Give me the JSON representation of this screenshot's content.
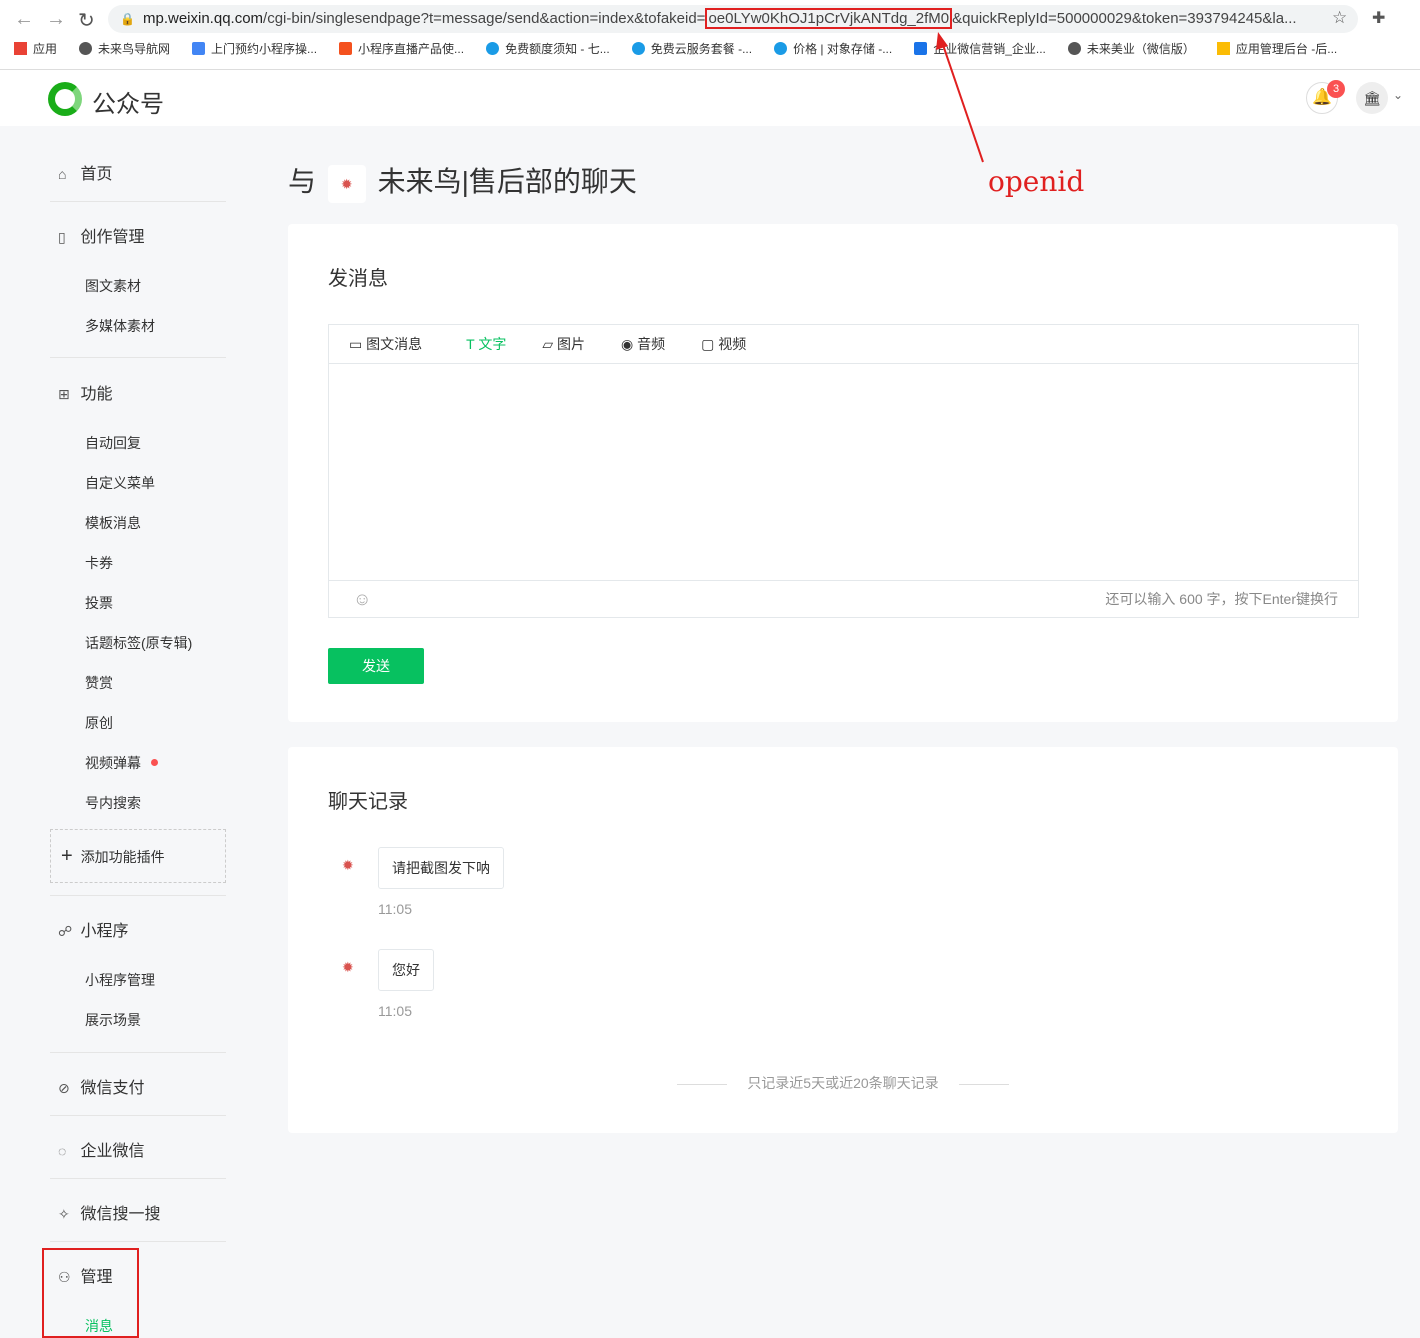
{
  "browser": {
    "url_prefix": "mp.weixin.qq.com",
    "url_path": "/cgi-bin/singlesendpage?t=message/send&action=index&tofakeid=",
    "url_highlight": "oe0LYw0KhOJ1pCrVjkANTdg_2fM0",
    "url_suffix": "&quickReplyId=500000029&token=393794245&la...",
    "bookmarks": [
      "应用",
      "未来鸟导航网",
      "上门预约小程序操...",
      "小程序直播产品使...",
      "免费额度须知 - 七...",
      "免费云服务套餐 -...",
      "价格 | 对象存储 -...",
      "企业微信营销_企业...",
      "未来美业（微信版）",
      "应用管理后台 -后..."
    ]
  },
  "header": {
    "logo": "公众号",
    "notifications": "3"
  },
  "sidebar": {
    "home": "首页",
    "create": "创作管理",
    "create_items": [
      "图文素材",
      "多媒体素材"
    ],
    "features": "功能",
    "feature_items": [
      "自动回复",
      "自定义菜单",
      "模板消息",
      "卡券",
      "投票",
      "话题标签(原专辑)",
      "赞赏",
      "原创",
      "视频弹幕",
      "号内搜索"
    ],
    "add_plugin": "添加功能插件",
    "miniprogram": "小程序",
    "mini_items": [
      "小程序管理",
      "展示场景"
    ],
    "pay": "微信支付",
    "work": "企业微信",
    "search": "微信搜一搜",
    "manage": "管理",
    "manage_items": [
      "消息"
    ]
  },
  "page": {
    "title_prefix": "与",
    "title_name": "未来鸟|售后部的聊天"
  },
  "compose": {
    "heading": "发消息",
    "tabs": [
      "图文消息",
      "文字",
      "图片",
      "音频",
      "视频"
    ],
    "counter": "还可以输入 600 字，按下Enter键换行",
    "send": "发送"
  },
  "history": {
    "heading": "聊天记录",
    "messages": [
      {
        "text": "请把截图发下呐",
        "time": "11:05"
      },
      {
        "text": "您好",
        "time": "11:05"
      }
    ],
    "note": "只记录近5天或近20条聊天记录"
  },
  "annotation": {
    "label": "openid"
  }
}
